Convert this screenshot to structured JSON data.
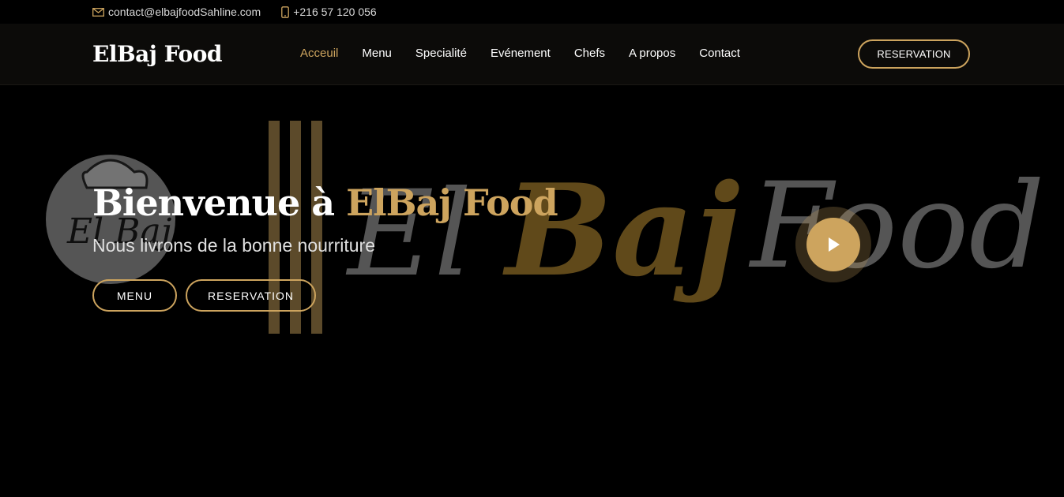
{
  "topbar": {
    "email": "contact@elbajfoodSahline.com",
    "email_icon": "envelope-icon",
    "phone": "+216 57 120 056",
    "phone_icon": "phone-icon"
  },
  "header": {
    "logo": "ElBaj Food",
    "nav": [
      {
        "label": "Acceuil",
        "active": true
      },
      {
        "label": "Menu"
      },
      {
        "label": "Specialité"
      },
      {
        "label": "Evénement"
      },
      {
        "label": "Chefs"
      },
      {
        "label": "A propos"
      },
      {
        "label": "Contact"
      }
    ],
    "reservation_label": "RESERVATION"
  },
  "hero": {
    "title_prefix": "Bienvenue à",
    "title_accent": "ElBaj Food",
    "subtitle": "Nous livrons de la bonne nourriture",
    "menu_button": "MENU",
    "reservation_button": "RESERVATION",
    "play_icon": "play-icon"
  },
  "colors": {
    "accent": "#cda45e",
    "background": "#000000",
    "header_bg": "#0c0b09"
  }
}
